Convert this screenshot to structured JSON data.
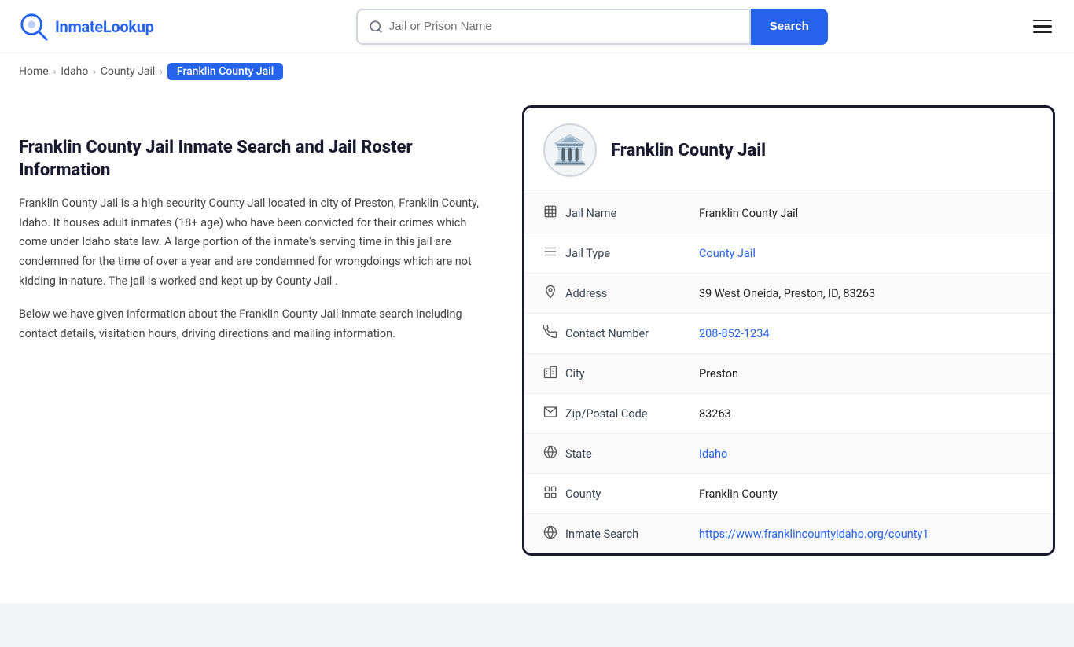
{
  "header": {
    "logo_text_prefix": "Inmate",
    "logo_text_suffix": "Lookup",
    "search_placeholder": "Jail or Prison Name",
    "search_button_label": "Search"
  },
  "breadcrumb": {
    "home": "Home",
    "state": "Idaho",
    "jail_type": "County Jail",
    "current": "Franklin County Jail"
  },
  "left": {
    "page_title": "Franklin County Jail Inmate Search and Jail Roster Information",
    "description1": "Franklin County Jail is a high security County Jail located in city of Preston, Franklin County, Idaho. It houses adult inmates (18+ age) who have been convicted for their crimes which come under Idaho state law. A large portion of the inmate's serving time in this jail are condemned for the time of over a year and are condemned for wrongdoings which are not kidding in nature. The jail is worked and kept up by County Jail .",
    "description2": "Below we have given information about the Franklin County Jail inmate search including contact details, visitation hours, driving directions and mailing information."
  },
  "card": {
    "jail_name": "Franklin County Jail",
    "rows": [
      {
        "icon": "jail-icon",
        "label": "Jail Name",
        "value": "Franklin County Jail",
        "link": null
      },
      {
        "icon": "type-icon",
        "label": "Jail Type",
        "value": "County Jail",
        "link": "#"
      },
      {
        "icon": "address-icon",
        "label": "Address",
        "value": "39 West Oneida, Preston, ID, 83263",
        "link": null
      },
      {
        "icon": "phone-icon",
        "label": "Contact Number",
        "value": "208-852-1234",
        "link": "tel:208-852-1234"
      },
      {
        "icon": "city-icon",
        "label": "City",
        "value": "Preston",
        "link": null
      },
      {
        "icon": "zip-icon",
        "label": "Zip/Postal Code",
        "value": "83263",
        "link": null
      },
      {
        "icon": "state-icon",
        "label": "State",
        "value": "Idaho",
        "link": "#"
      },
      {
        "icon": "county-icon",
        "label": "County",
        "value": "Franklin County",
        "link": null
      },
      {
        "icon": "globe-icon",
        "label": "Inmate Search",
        "value": "https://www.franklincountyidaho.org/county1",
        "link": "https://www.franklincountyidaho.org/county1"
      }
    ]
  }
}
